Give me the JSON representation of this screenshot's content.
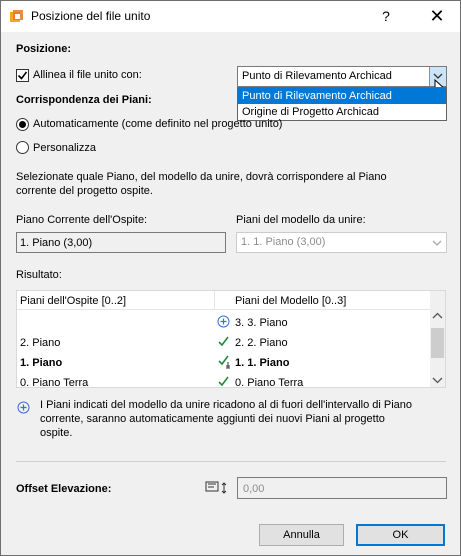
{
  "window": {
    "title": "Posizione del file unito",
    "help_label": "?",
    "close_label": "✕"
  },
  "posizione": {
    "heading": "Posizione:",
    "align_checkbox_label": "Allinea il file unito con:",
    "align_checked": true,
    "align_selected": "Punto di Rilevamento Archicad",
    "align_options": [
      "Punto di Rilevamento Archicad",
      "Origine di Progetto Archicad"
    ]
  },
  "piani": {
    "heading": "Corrispondenza dei Piani:",
    "radio_auto": "Automaticamente (come definito nel progetto unito)",
    "radio_custom": "Personalizza",
    "selected": "auto",
    "description": [
      "Selezionate quale Piano, del modello da unire, dovrà corrispondere al Piano",
      "corrente del progetto ospite."
    ],
    "host_label": "Piano Corrente dell'Ospite:",
    "host_value": "1. Piano (3,00)",
    "model_label": "Piani del modello da unire:",
    "model_value": "1. 1. Piano (3,00)"
  },
  "risultato": {
    "heading": "Risultato:",
    "header_host": "Piani dell'Ospite [0..2]",
    "header_model": "Piani del Modello [0..3]",
    "rows": [
      {
        "host": "",
        "status": "add",
        "model": "3. 3. Piano",
        "bold": false
      },
      {
        "host": "2. Piano",
        "status": "check",
        "model": "2. 2. Piano",
        "bold": false
      },
      {
        "host": "1. Piano",
        "status": "check-anchor",
        "model": "1. 1. Piano",
        "bold": true
      },
      {
        "host": "0. Piano Terra",
        "status": "check",
        "model": "0. Piano Terra",
        "bold": false
      }
    ],
    "note": [
      "I Piani indicati del modello da unire ricadono al di fuori dell'intervallo di Piano",
      "corrente, saranno automaticamente aggiunti dei nuovi Piani al progetto",
      "ospite."
    ]
  },
  "offset": {
    "label": "Offset Elevazione:",
    "value": "0,00"
  },
  "buttons": {
    "cancel": "Annulla",
    "ok": "OK"
  },
  "colors": {
    "accent": "#0078d7",
    "check": "#1e8c3a",
    "info": "#3a6fd8"
  }
}
